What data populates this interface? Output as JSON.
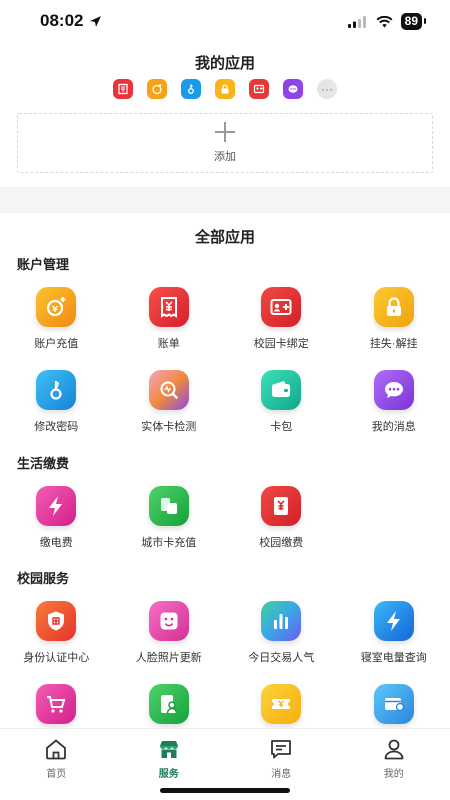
{
  "status": {
    "time": "08:02",
    "battery": "89"
  },
  "my_apps": {
    "title": "我的应用",
    "icons": [
      "bill-icon",
      "topup-icon",
      "key-icon",
      "lock-icon",
      "card-bind-icon",
      "message-icon",
      "more-icon"
    ],
    "more": "···",
    "add_label": "添加"
  },
  "all_apps_title": "全部应用",
  "sections": [
    {
      "title": "账户管理",
      "rows": [
        [
          {
            "label": "账户充值",
            "icon": "topup-icon",
            "color": "#f7a21b"
          },
          {
            "label": "账单",
            "icon": "bill-icon",
            "color": "#e8333a"
          },
          {
            "label": "校园卡绑定",
            "icon": "card-bind-icon",
            "color": "#e53935"
          },
          {
            "label": "挂失·解挂",
            "icon": "lock-icon",
            "color": "#f9b418"
          }
        ],
        [
          {
            "label": "修改密码",
            "icon": "key-icon",
            "color": "#1a9be8"
          },
          {
            "label": "实体卡检测",
            "icon": "scan-icon",
            "color": "#f08a3e"
          },
          {
            "label": "卡包",
            "icon": "wallet-icon",
            "color": "#14b89b"
          },
          {
            "label": "我的消息",
            "icon": "message-icon",
            "color": "#8e44e8"
          }
        ]
      ]
    },
    {
      "title": "生活缴费",
      "rows": [
        [
          {
            "label": "缴电费",
            "icon": "lightning-icon",
            "color": "#e83a9a"
          },
          {
            "label": "城市卡充值",
            "icon": "city-card-icon",
            "color": "#2bb04a"
          },
          {
            "label": "校园缴费",
            "icon": "campus-pay-icon",
            "color": "#e5343a"
          }
        ]
      ]
    },
    {
      "title": "校园服务",
      "rows": [
        [
          {
            "label": "身份认证中心",
            "icon": "shield-icon",
            "color": "#f04a2f"
          },
          {
            "label": "人脸照片更新",
            "icon": "face-icon",
            "color": "#e940b0"
          },
          {
            "label": "今日交易人气",
            "icon": "bar-chart-icon",
            "color": "#3fb3e8"
          },
          {
            "label": "寝室电量查询",
            "icon": "lightning-icon",
            "color": "#1e88e5"
          }
        ],
        [
          {
            "label": "",
            "icon": "cart-icon",
            "color": "#e83a9a"
          },
          {
            "label": "",
            "icon": "contact-icon",
            "color": "#2bb04a"
          },
          {
            "label": "",
            "icon": "ticket-icon",
            "color": "#f7c21b"
          },
          {
            "label": "",
            "icon": "card-icon",
            "color": "#3fa5e8"
          }
        ]
      ]
    }
  ],
  "tabs": [
    {
      "label": "首页",
      "icon": "home-icon",
      "active": false
    },
    {
      "label": "服务",
      "icon": "store-icon",
      "active": true
    },
    {
      "label": "消息",
      "icon": "chat-icon",
      "active": false
    },
    {
      "label": "我的",
      "icon": "user-icon",
      "active": false
    }
  ],
  "colors": {
    "accent": "#1e7e5a"
  }
}
